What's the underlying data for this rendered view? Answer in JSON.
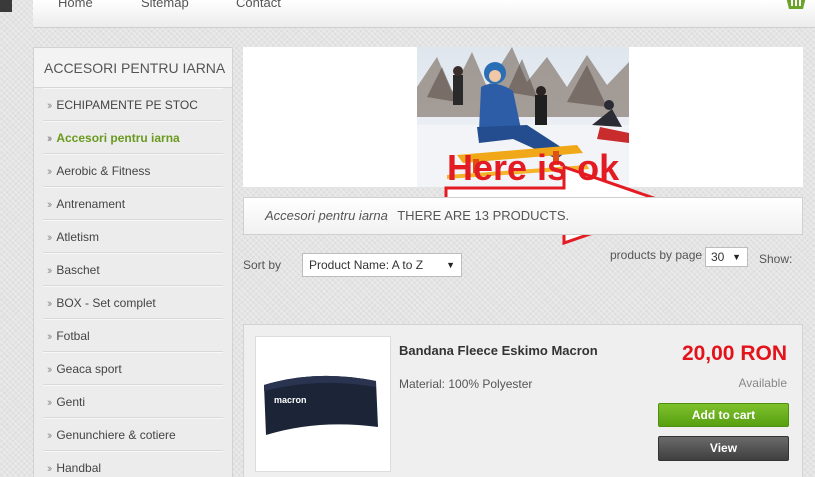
{
  "nav": {
    "home": "Home",
    "sitemap": "Sitemap",
    "contact": "Contact",
    "cart_icon": "shopping-basket-icon"
  },
  "sidebar": {
    "title": "ACCESORI PENTRU IARNA",
    "items": [
      {
        "label": "ECHIPAMENTE PE STOC"
      },
      {
        "label": "Accesori pentru iarna",
        "active": true
      },
      {
        "label": "Aerobic & Fitness"
      },
      {
        "label": "Antrenament"
      },
      {
        "label": "Atletism"
      },
      {
        "label": "Baschet"
      },
      {
        "label": "BOX - Set complet"
      },
      {
        "label": "Fotbal"
      },
      {
        "label": "Geaca sport"
      },
      {
        "label": "Genti"
      },
      {
        "label": "Genunchiere & cotiere"
      },
      {
        "label": "Handbal"
      }
    ]
  },
  "banner": {
    "annotation": "Here is ok",
    "annotation_color": "#e31b23"
  },
  "category_bar": {
    "name": "Accesori pentru iarna",
    "count_text": "THERE ARE 13 PRODUCTS."
  },
  "controls": {
    "sort_label": "Sort by",
    "sort_value": "Product Name: A to Z",
    "perpage_label": "products by page",
    "perpage_value": "30",
    "show_label": "Show:"
  },
  "product": {
    "name": "Bandana Fleece Eskimo Macron",
    "material": "Material: 100% Polyester",
    "price": "20,00 RON",
    "availability": "Available",
    "add_to_cart": "Add to cart",
    "view": "View",
    "image_logo": "macron"
  },
  "colors": {
    "accent_green": "#6a9a1f",
    "price_red": "#e3121b"
  }
}
